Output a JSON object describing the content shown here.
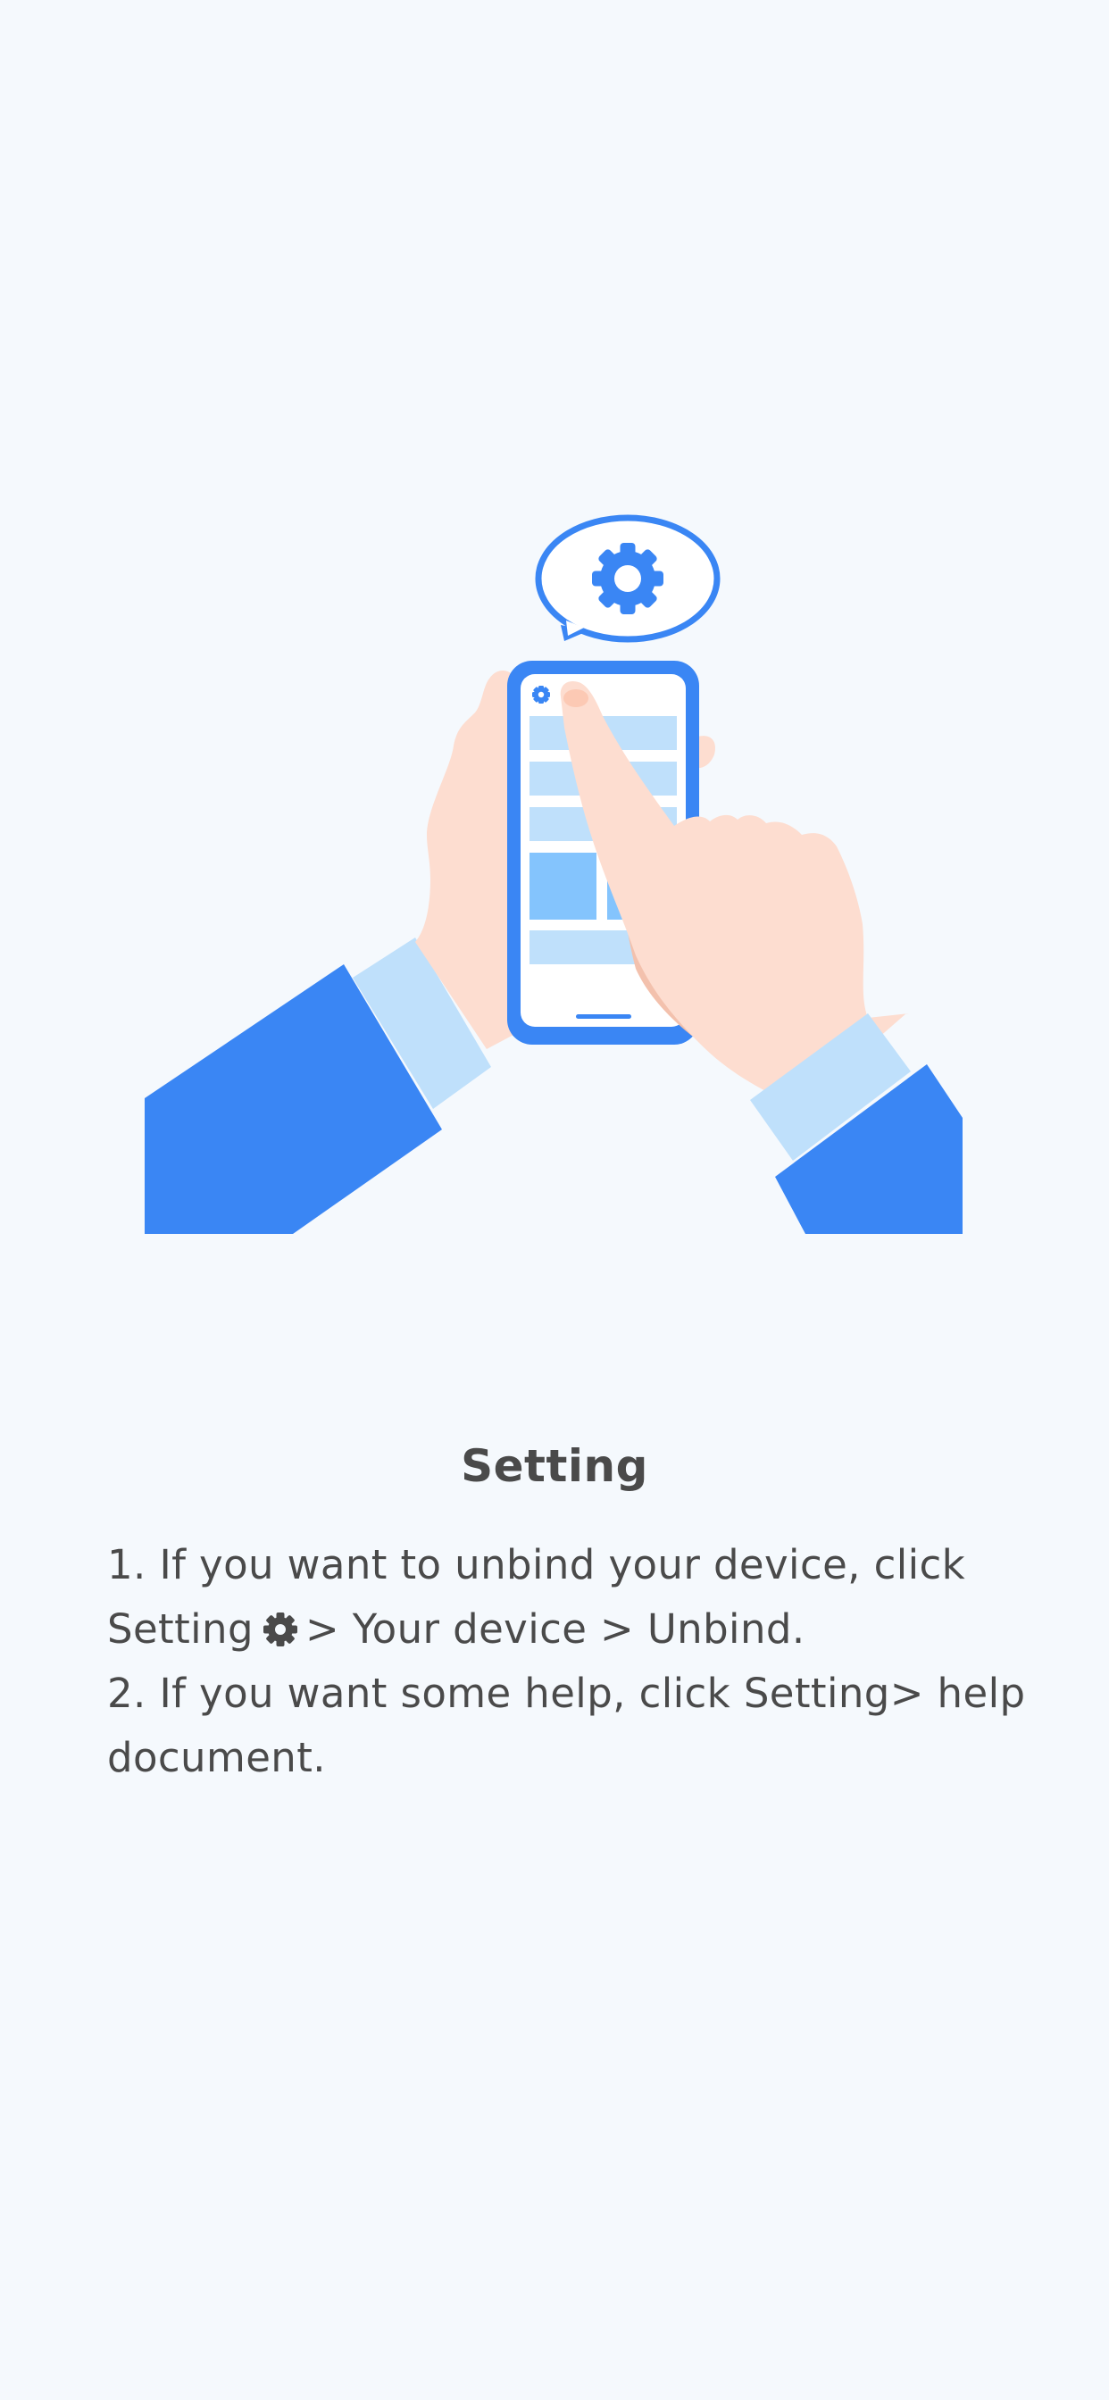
{
  "colors": {
    "background": "#f5f9fd",
    "accent_blue": "#3a86f4",
    "light_blue": "#bfe0fb",
    "skin": "#fdddd0",
    "skin_shadow": "#f3c1ad",
    "text": "#4a4a4a"
  },
  "illustration": {
    "icons": [
      "gear-icon",
      "speech-bubble",
      "phone",
      "hand-holding-phone",
      "hand-tapping"
    ]
  },
  "title": "Setting",
  "instructions": {
    "step1_line1": "1. If you want to unbind your device, click",
    "step1_line2_before_icon": "Setting",
    "step1_icon": "gear-icon",
    "step1_line2_after_icon": "> Your device > Unbind.",
    "step2_line1": "2. If you want some help, click Setting> help",
    "step2_line2": "document."
  }
}
